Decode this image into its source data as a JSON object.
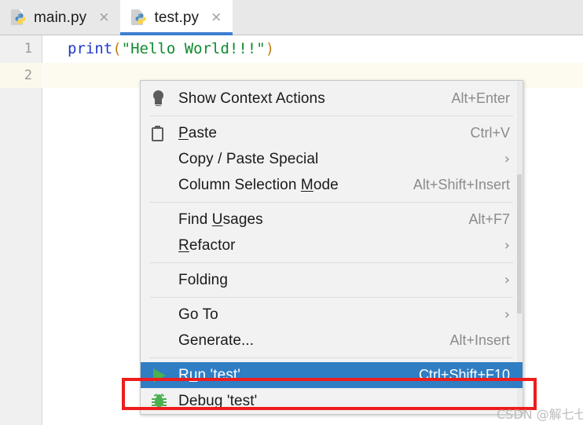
{
  "tabs": [
    {
      "label": "main.py",
      "icon": "python-file-icon",
      "close": "×",
      "active": false
    },
    {
      "label": "test.py",
      "icon": "python-file-icon",
      "close": "×",
      "active": true
    }
  ],
  "editor": {
    "line_numbers": [
      "1",
      "2"
    ],
    "code": {
      "func": "print",
      "open_paren": "(",
      "string": "\"Hello World!!!\"",
      "close_paren": ")"
    }
  },
  "context_menu": {
    "items": [
      {
        "label": "Show Context Actions",
        "shortcut": "Alt+Enter",
        "icon": "lightbulb-icon",
        "arrow": "",
        "mnemonic": ""
      },
      {
        "label": "Paste",
        "shortcut": "Ctrl+V",
        "icon": "clipboard-icon",
        "arrow": "",
        "mnemonic": "P"
      },
      {
        "label": "Copy / Paste Special",
        "shortcut": "",
        "icon": "",
        "arrow": "›",
        "mnemonic": ""
      },
      {
        "label": "Column Selection Mode",
        "shortcut": "Alt+Shift+Insert",
        "icon": "",
        "arrow": "",
        "mnemonic": "M"
      },
      {
        "label": "Find Usages",
        "shortcut": "Alt+F7",
        "icon": "",
        "arrow": "",
        "mnemonic": "U"
      },
      {
        "label": "Refactor",
        "shortcut": "",
        "icon": "",
        "arrow": "›",
        "mnemonic": "R"
      },
      {
        "label": "Folding",
        "shortcut": "",
        "icon": "",
        "arrow": "›",
        "mnemonic": ""
      },
      {
        "label": "Go To",
        "shortcut": "",
        "icon": "",
        "arrow": "›",
        "mnemonic": ""
      },
      {
        "label": "Generate...",
        "shortcut": "Alt+Insert",
        "icon": "",
        "arrow": "",
        "mnemonic": ""
      },
      {
        "label": "Run 'test'",
        "shortcut": "Ctrl+Shift+F10",
        "icon": "run-play-icon",
        "arrow": "",
        "mnemonic": "u",
        "selected": true
      },
      {
        "label": "Debug 'test'",
        "shortcut": "",
        "icon": "debug-bug-icon",
        "arrow": "",
        "mnemonic": ""
      }
    ]
  },
  "annotation": {
    "color": "#ee1c1c"
  },
  "watermark": {
    "text": "CSDN @解七七"
  },
  "colors": {
    "selection_blue": "#2f7ec4",
    "tab_underline": "#3c7fd0",
    "keyword": "#2038c8",
    "string": "#0f8a2e",
    "paren": "#c08020",
    "run_green": "#4caf50"
  }
}
